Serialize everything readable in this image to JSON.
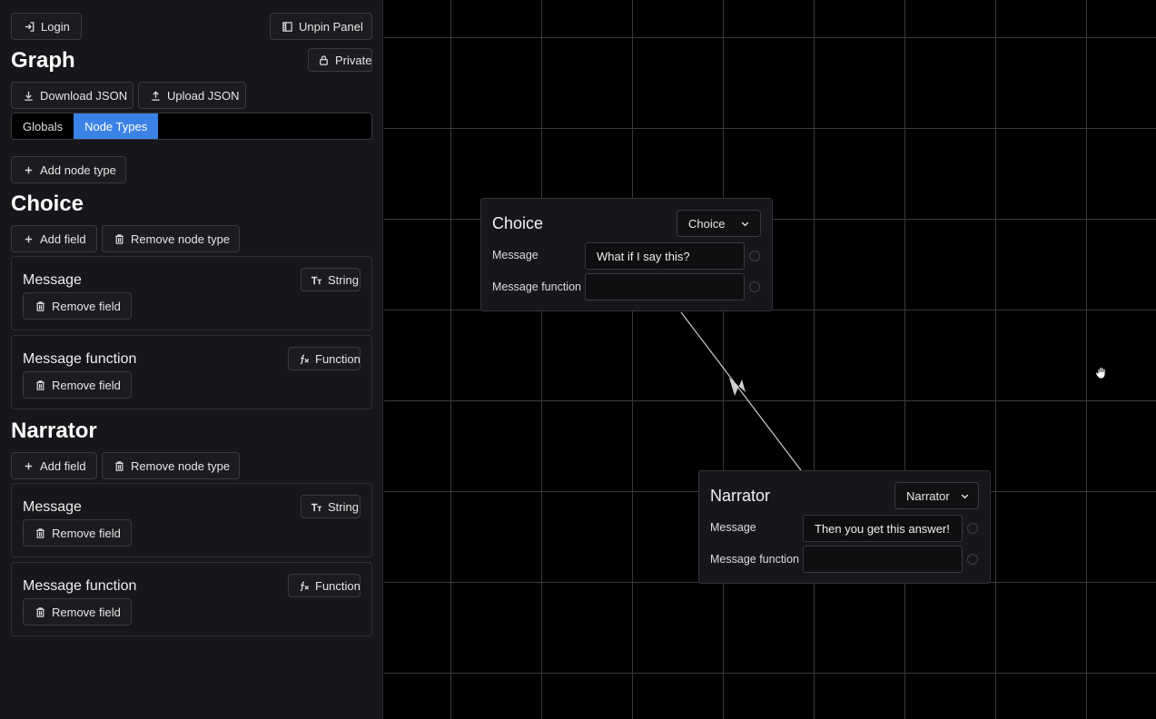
{
  "panel": {
    "login_label": "Login",
    "unpin_label": "Unpin Panel",
    "graph_title": "Graph",
    "private_label": "Private",
    "download_label": "Download JSON",
    "upload_label": "Upload JSON",
    "tabs": [
      "Globals",
      "Node Types"
    ],
    "active_tab": "Node Types",
    "add_node_type_label": "Add node type",
    "node_types": [
      {
        "name": "Choice",
        "add_field_label": "Add field",
        "remove_type_label": "Remove node type",
        "fields": [
          {
            "name": "Message",
            "type": "String",
            "type_icon": "text-type-icon",
            "remove_label": "Remove field"
          },
          {
            "name": "Message function",
            "type": "Function",
            "type_icon": "function-icon",
            "remove_label": "Remove field"
          }
        ]
      },
      {
        "name": "Narrator",
        "add_field_label": "Add field",
        "remove_type_label": "Remove node type",
        "fields": [
          {
            "name": "Message",
            "type": "String",
            "type_icon": "text-type-icon",
            "remove_label": "Remove field"
          },
          {
            "name": "Message function",
            "type": "Function",
            "type_icon": "function-icon",
            "remove_label": "Remove field"
          }
        ]
      }
    ]
  },
  "canvas": {
    "nodes": [
      {
        "title": "Choice",
        "type_select": "Choice",
        "fields": [
          {
            "label": "Message",
            "value": "What if I say this?"
          },
          {
            "label": "Message function",
            "value": ""
          }
        ]
      },
      {
        "title": "Narrator",
        "type_select": "Narrator",
        "fields": [
          {
            "label": "Message",
            "value": "Then you get this answer!"
          },
          {
            "label": "Message function",
            "value": ""
          }
        ]
      }
    ]
  },
  "colors": {
    "accent": "#3a82e6",
    "panel_bg": "#17171b",
    "canvas_bg": "#000000",
    "grid_line": "#3a3a3a"
  }
}
